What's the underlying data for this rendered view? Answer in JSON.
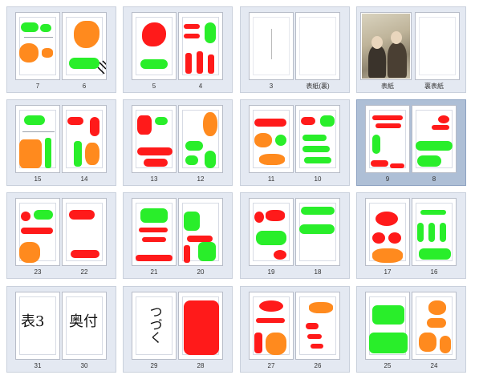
{
  "spreads": [
    {
      "left_page": "7",
      "right_page": "6"
    },
    {
      "left_page": "5",
      "right_page": "4"
    },
    {
      "left_page": "3",
      "right_page": "表紙(裏)"
    },
    {
      "left_page": "表紙",
      "right_page": "裏表紙"
    },
    {
      "left_page": "15",
      "right_page": "14"
    },
    {
      "left_page": "13",
      "right_page": "12"
    },
    {
      "left_page": "11",
      "right_page": "10"
    },
    {
      "left_page": "9",
      "right_page": "8"
    },
    {
      "left_page": "23",
      "right_page": "22"
    },
    {
      "left_page": "21",
      "right_page": "20"
    },
    {
      "left_page": "19",
      "right_page": "18"
    },
    {
      "left_page": "17",
      "right_page": "16"
    },
    {
      "left_page": "31",
      "right_page": "30"
    },
    {
      "left_page": "29",
      "right_page": "28"
    },
    {
      "left_page": "27",
      "right_page": "26"
    },
    {
      "left_page": "25",
      "right_page": "24"
    }
  ],
  "selected_spread": "9-8",
  "handwriting": {
    "p31": "表3",
    "p30": "奥付",
    "p29": "つづく"
  },
  "colors": {
    "green": "#29ee2a",
    "red": "#ff1a1a",
    "orange": "#ff8a1e",
    "thumb_bg": "#e4e9f2",
    "selected_bg": "#aebfd6"
  }
}
